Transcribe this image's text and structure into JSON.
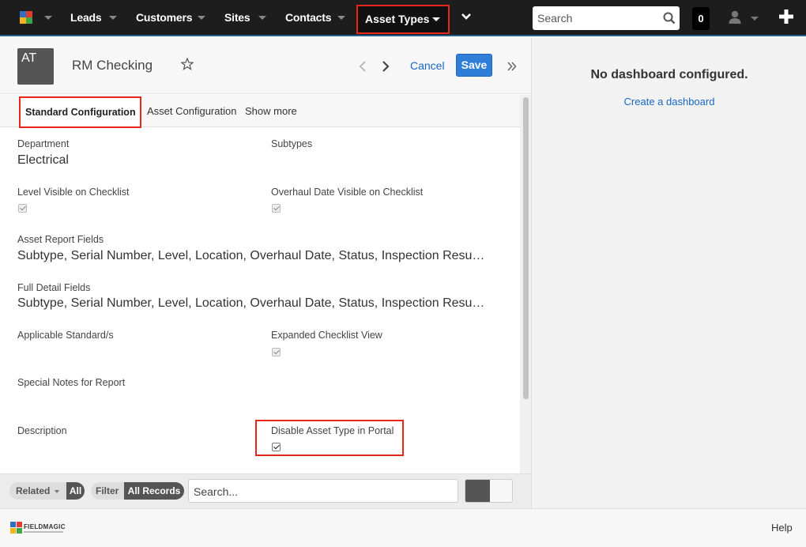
{
  "topnav": {
    "items": [
      {
        "label": "Leads"
      },
      {
        "label": "Customers"
      },
      {
        "label": "Sites"
      },
      {
        "label": "Contacts"
      }
    ],
    "active_item": "Asset Types",
    "search_placeholder": "Search",
    "notification_count": "0"
  },
  "record": {
    "avatar_initials": "AT",
    "title": "RM Checking",
    "cancel_label": "Cancel",
    "save_label": "Save"
  },
  "tabs": [
    "Standard Configuration",
    "Asset Configuration",
    "Show more"
  ],
  "fields": {
    "department": {
      "label": "Department",
      "value": "Electrical"
    },
    "subtypes": {
      "label": "Subtypes",
      "value": ""
    },
    "level_visible": {
      "label": "Level Visible on Checklist",
      "checked": true
    },
    "overhaul_visible": {
      "label": "Overhaul Date Visible on Checklist",
      "checked": true
    },
    "asset_report_fields": {
      "label": "Asset Report Fields",
      "value": "Subtype, Serial Number, Level, Location, Overhaul Date, Status, Inspection Resu…"
    },
    "full_detail_fields": {
      "label": "Full Detail Fields",
      "value": "Subtype, Serial Number, Level, Location, Overhaul Date, Status, Inspection Resu…"
    },
    "applicable_standards": {
      "label": "Applicable Standard/s",
      "value": ""
    },
    "expanded_checklist": {
      "label": "Expanded Checklist View",
      "checked": true
    },
    "special_notes": {
      "label": "Special Notes for Report",
      "value": ""
    },
    "description": {
      "label": "Description",
      "value": ""
    },
    "disable_portal": {
      "label": "Disable Asset Type in Portal",
      "checked": true
    }
  },
  "subpanel": {
    "related_label": "Related",
    "related_value": "All",
    "filter_label": "Filter",
    "filter_value": "All Records",
    "search_placeholder": "Search..."
  },
  "dashboard": {
    "empty_message": "No dashboard configured.",
    "create_link": "Create a dashboard"
  },
  "footer": {
    "brand": "FIELDMAGIC",
    "help_label": "Help"
  },
  "colors": {
    "nav_bg": "#1d1d1d",
    "highlight": "#e8261c",
    "link": "#1a66c7",
    "save_button": "#2f7ed8"
  }
}
